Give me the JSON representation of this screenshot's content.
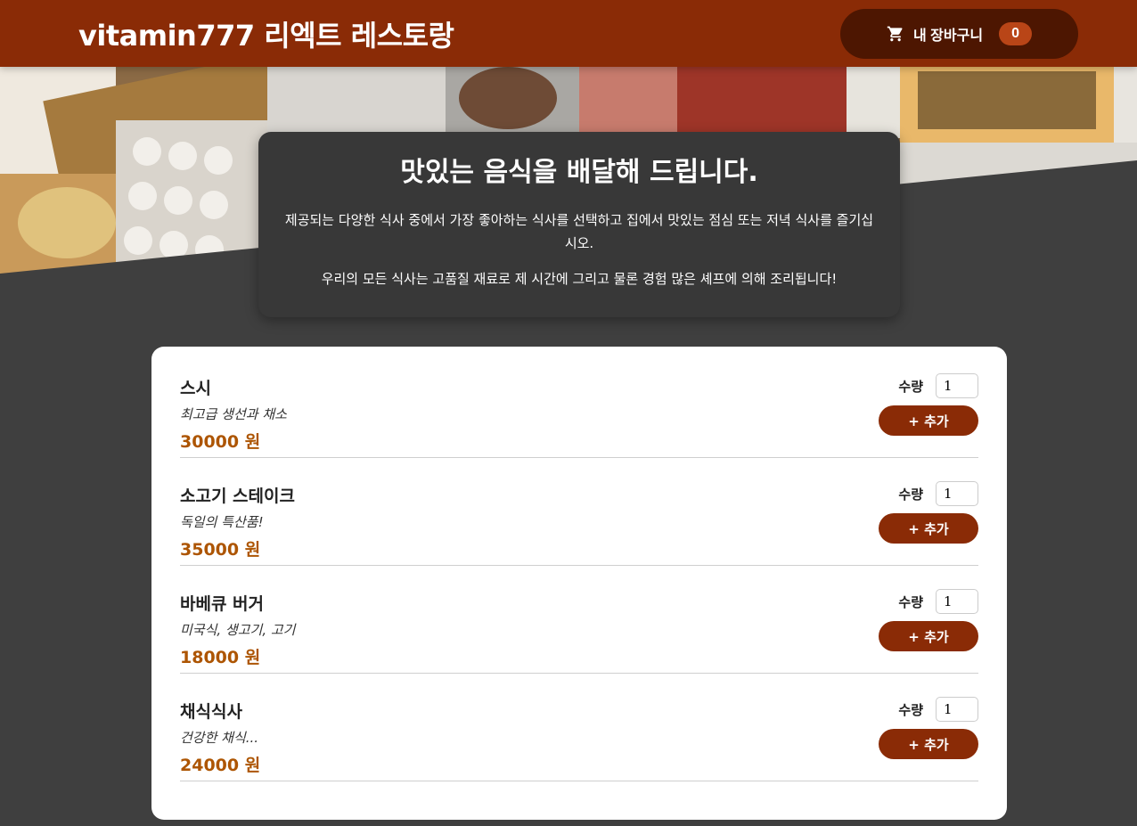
{
  "header": {
    "title": "vitamin777 리엑트 레스토랑",
    "cart_label": "내 장바구니",
    "cart_count": "0",
    "cart_icon": "cart-icon"
  },
  "summary": {
    "heading": "맛있는 음식을 배달해 드립니다.",
    "paragraph1": "제공되는 다양한 식사 중에서 가장 좋아하는 식사를 선택하고 집에서 맛있는 점심 또는 저녁 식사를 즐기십시오.",
    "paragraph2": "우리의 모든 식사는 고품질 재료로 제 시간에 그리고 물론 경험 많은 셰프에 의해 조리됩니다!"
  },
  "meals": [
    {
      "name": "스시",
      "description": "최고급 생선과 채소",
      "price": "30000 원",
      "amount_label": "수량",
      "amount": "1",
      "add_label": "+ 추가"
    },
    {
      "name": "소고기 스테이크",
      "description": "독일의 특산품!",
      "price": "35000 원",
      "amount_label": "수량",
      "amount": "1",
      "add_label": "+ 추가"
    },
    {
      "name": "바베큐 버거",
      "description": "미국식, 생고기, 고기",
      "price": "18000 원",
      "amount_label": "수량",
      "amount": "1",
      "add_label": "+ 추가"
    },
    {
      "name": "채식식사",
      "description": "건강한 채식...",
      "price": "24000 원",
      "amount_label": "수량",
      "amount": "1",
      "add_label": "+ 추가"
    }
  ],
  "colors": {
    "header": "#8a2b06",
    "cart_button": "#4d1601",
    "badge": "#b94517",
    "price": "#ad5502",
    "background": "#3f3f3f"
  }
}
